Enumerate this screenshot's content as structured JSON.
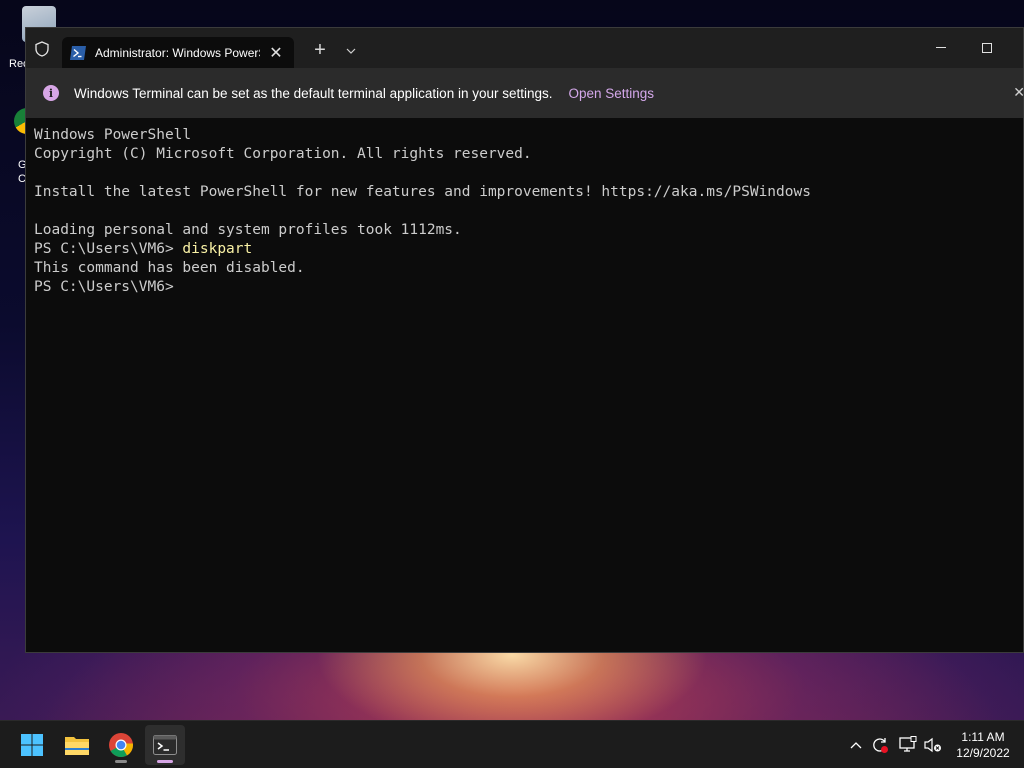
{
  "desktop": {
    "icons": [
      {
        "label": "Rec"
      },
      {
        "label": "G\nC"
      }
    ]
  },
  "window": {
    "tab": {
      "title": "Administrator: Windows PowerShell"
    }
  },
  "infobar": {
    "message": "Windows Terminal can be set as the default terminal application in your settings.",
    "link": "Open Settings"
  },
  "terminal": {
    "lines": [
      {
        "text": "Windows PowerShell"
      },
      {
        "text": "Copyright (C) Microsoft Corporation. All rights reserved."
      },
      {
        "text": ""
      },
      {
        "text": "Install the latest PowerShell for new features and improvements! https://aka.ms/PSWindows"
      },
      {
        "text": ""
      },
      {
        "text": "Loading personal and system profiles took 1112ms."
      },
      {
        "prompt": "PS C:\\Users\\VM6> ",
        "command": "diskpart"
      },
      {
        "text": "This command has been disabled."
      },
      {
        "prompt": "PS C:\\Users\\VM6>",
        "command": ""
      }
    ]
  },
  "taskbar": {
    "clock": {
      "time": "1:11 AM",
      "date": "12/9/2022"
    }
  },
  "colors": {
    "terminal_bg": "#0c0c0c",
    "terminal_fg": "#cccccc",
    "command_fg": "#f9f1a5",
    "accent": "#d4a8ea"
  }
}
